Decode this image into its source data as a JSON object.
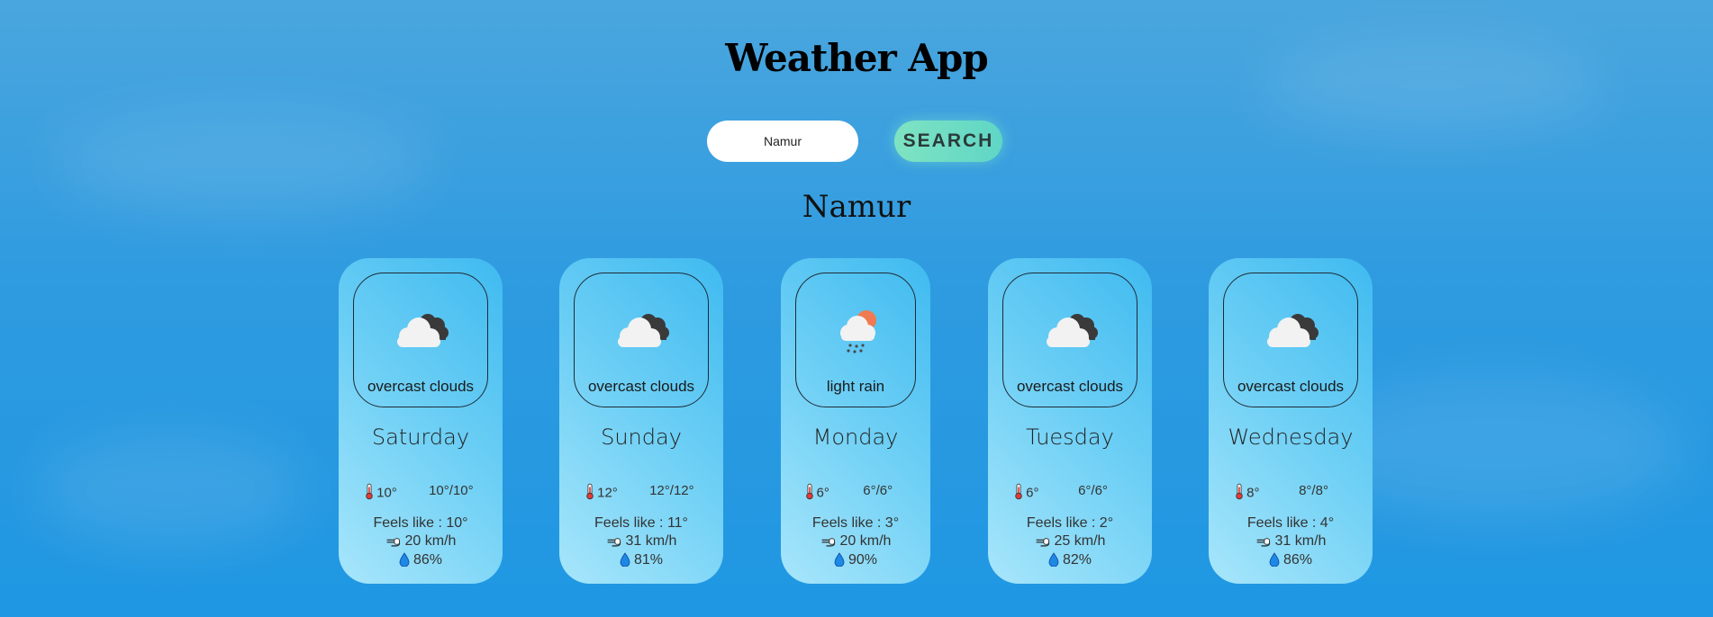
{
  "app": {
    "title": "Weather App"
  },
  "search": {
    "value": "Namur",
    "placeholder": "",
    "button_label": "SEARCH"
  },
  "city": "Namur",
  "colors": {
    "accent_button": "#6fdcc4",
    "card_light": "#a8e6fb",
    "card_dark": "#3fbaf0",
    "background": "#2f9be0"
  },
  "forecast": [
    {
      "day": "Saturday",
      "description": "overcast clouds",
      "icon": "overcast-clouds-icon",
      "temp": "10°",
      "minmax": "10°/10°",
      "feels": "Feels like : 10°",
      "wind": "20 km/h",
      "humidity": "86%"
    },
    {
      "day": "Sunday",
      "description": "overcast clouds",
      "icon": "overcast-clouds-icon",
      "temp": "12°",
      "minmax": "12°/12°",
      "feels": "Feels like : 11°",
      "wind": "31 km/h",
      "humidity": "81%"
    },
    {
      "day": "Monday",
      "description": "light rain",
      "icon": "light-rain-icon",
      "temp": "6°",
      "minmax": "6°/6°",
      "feels": "Feels like : 3°",
      "wind": "20 km/h",
      "humidity": "90%"
    },
    {
      "day": "Tuesday",
      "description": "overcast clouds",
      "icon": "overcast-clouds-icon",
      "temp": "6°",
      "minmax": "6°/6°",
      "feels": "Feels like : 2°",
      "wind": "25 km/h",
      "humidity": "82%"
    },
    {
      "day": "Wednesday",
      "description": "overcast clouds",
      "icon": "overcast-clouds-icon",
      "temp": "8°",
      "minmax": "8°/8°",
      "feels": "Feels like : 4°",
      "wind": "31 km/h",
      "humidity": "86%"
    }
  ]
}
